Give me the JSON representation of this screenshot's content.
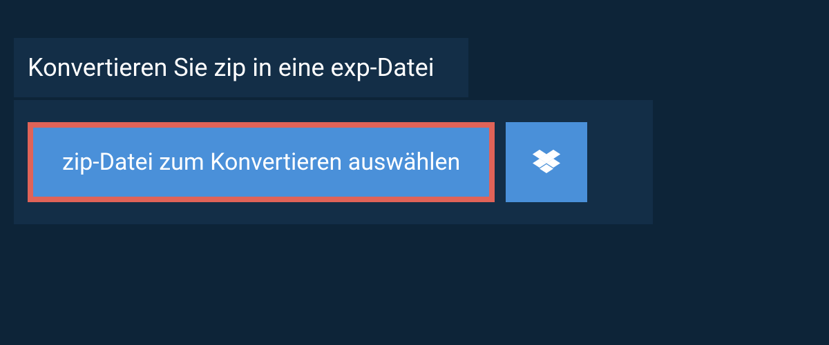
{
  "header": {
    "title": "Konvertieren Sie zip in eine exp-Datei"
  },
  "actions": {
    "select_file_label": "zip-Datei zum Konvertieren auswählen",
    "cloud_provider": "dropbox"
  },
  "colors": {
    "background": "#0d2438",
    "panel": "#132e47",
    "button": "#4a90d9",
    "highlight_border": "#e06358"
  }
}
